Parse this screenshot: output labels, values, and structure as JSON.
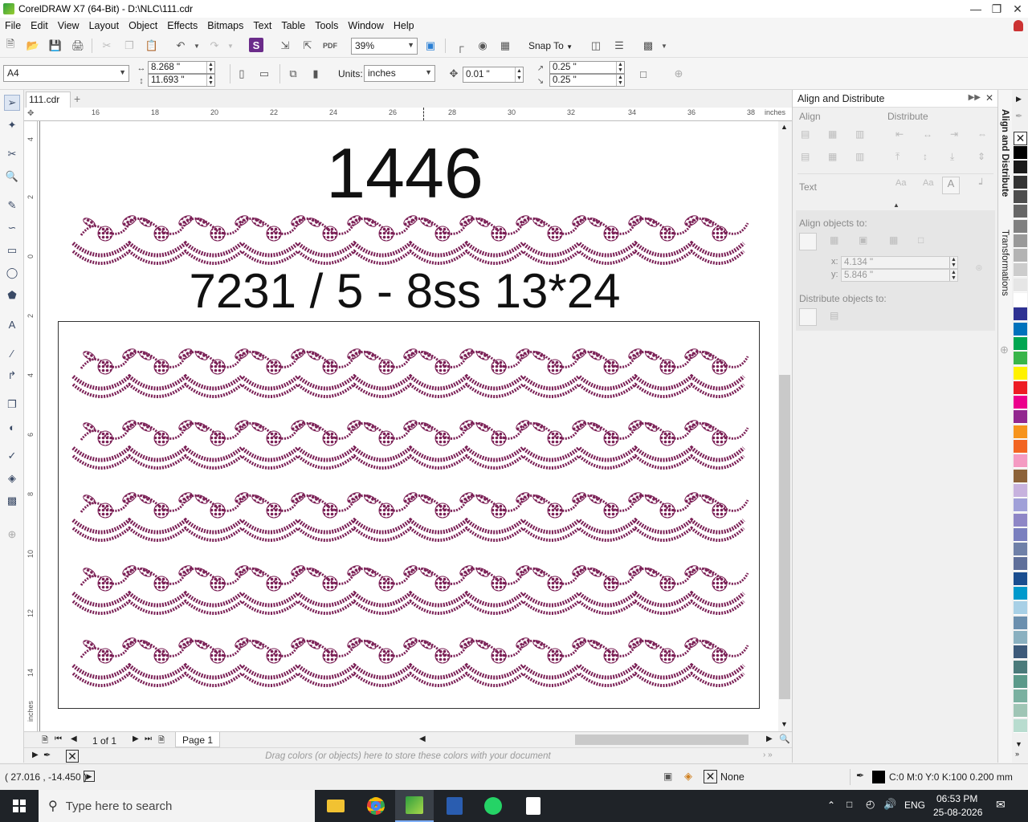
{
  "window": {
    "title": "CorelDRAW X7 (64-Bit) - D:\\NLC\\111.cdr"
  },
  "menu": [
    "File",
    "Edit",
    "View",
    "Layout",
    "Object",
    "Effects",
    "Bitmaps",
    "Text",
    "Table",
    "Tools",
    "Window",
    "Help"
  ],
  "toolbar": {
    "zoom": "39%",
    "snap_to": "Snap To"
  },
  "property_bar": {
    "page_size": "A4",
    "width": "8.268 \"",
    "height": "11.693 \"",
    "units_label": "Units:",
    "units": "inches",
    "nudge": "0.01 \"",
    "dup_x": "0.25 \"",
    "dup_y": "0.25 \""
  },
  "doc_tab": "111.cdr",
  "ruler": {
    "h_ticks": [
      "16",
      "18",
      "20",
      "22",
      "24",
      "26",
      "28",
      "30",
      "32",
      "34",
      "36",
      "38"
    ],
    "h_unit": "inches",
    "v_ticks": [
      "4",
      "2",
      "0",
      "2",
      "4",
      "6",
      "8",
      "10",
      "12",
      "14"
    ],
    "v_unit": "inches"
  },
  "canvas": {
    "heading_number": "1446",
    "heading_code": "7231 / 5 - 8ss 13*24",
    "motif_color": "#7a1f55",
    "rows": 6
  },
  "page_nav": {
    "counter": "1 of 1",
    "page_tab": "Page 1"
  },
  "doc_palette_hint": "Drag colors (or objects) here to store these colors with your document",
  "docker": {
    "title": "Align and Distribute",
    "align": "Align",
    "distribute": "Distribute",
    "text": "Text",
    "align_objects_to": "Align objects to:",
    "x_label": "x:",
    "x_value": "4.134 \"",
    "y_label": "y:",
    "y_value": "5.846 \"",
    "distribute_objects_to": "Distribute objects to:",
    "tabs": [
      "Align and Distribute",
      "Transformations"
    ]
  },
  "palette_colors": [
    "#000000",
    "#1a1a1a",
    "#333333",
    "#4d4d4d",
    "#666666",
    "#808080",
    "#999999",
    "#b3b3b3",
    "#cccccc",
    "#e6e6e6",
    "#ffffff",
    "#2e3192",
    "#0072bc",
    "#00a651",
    "#39b54a",
    "#fff200",
    "#ed1c24",
    "#ec008c",
    "#92278f",
    "#f7941d",
    "#f26522",
    "#f49ac2",
    "#8c6239",
    "#c7b2de",
    "#a0a0d8",
    "#8e86c6",
    "#7a7fbf",
    "#6f80a8",
    "#5f6f9a",
    "#1a4d8f",
    "#0099cc",
    "#a8d0e6",
    "#6b8fae",
    "#8ab0c0",
    "#3d5a7a",
    "#4a7a7a",
    "#5b9a8a",
    "#7ab0a0",
    "#9fc5b5",
    "#b8dccf"
  ],
  "status": {
    "coords": "( 27.016 , -14.450 )",
    "fill": "None",
    "outline": "C:0 M:0 Y:0 K:100  0.200 mm"
  },
  "taskbar": {
    "search_placeholder": "Type here to search",
    "lang": "ENG",
    "time": "06:53 PM",
    "date": "25-08-2026"
  }
}
